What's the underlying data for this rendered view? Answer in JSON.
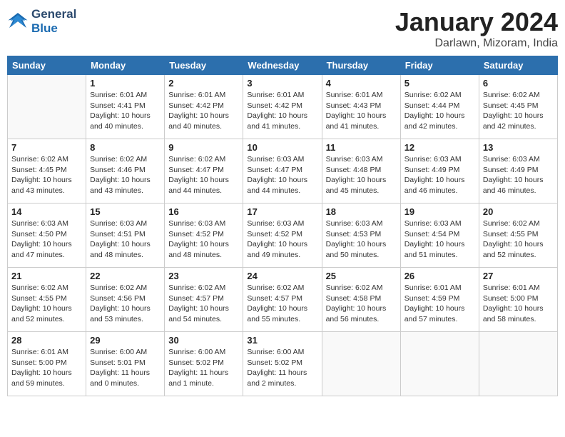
{
  "header": {
    "logo_line1": "General",
    "logo_line2": "Blue",
    "month_title": "January 2024",
    "location": "Darlawn, Mizoram, India"
  },
  "days_of_week": [
    "Sunday",
    "Monday",
    "Tuesday",
    "Wednesday",
    "Thursday",
    "Friday",
    "Saturday"
  ],
  "weeks": [
    [
      {
        "day": "",
        "info": ""
      },
      {
        "day": "1",
        "info": "Sunrise: 6:01 AM\nSunset: 4:41 PM\nDaylight: 10 hours\nand 40 minutes."
      },
      {
        "day": "2",
        "info": "Sunrise: 6:01 AM\nSunset: 4:42 PM\nDaylight: 10 hours\nand 40 minutes."
      },
      {
        "day": "3",
        "info": "Sunrise: 6:01 AM\nSunset: 4:42 PM\nDaylight: 10 hours\nand 41 minutes."
      },
      {
        "day": "4",
        "info": "Sunrise: 6:01 AM\nSunset: 4:43 PM\nDaylight: 10 hours\nand 41 minutes."
      },
      {
        "day": "5",
        "info": "Sunrise: 6:02 AM\nSunset: 4:44 PM\nDaylight: 10 hours\nand 42 minutes."
      },
      {
        "day": "6",
        "info": "Sunrise: 6:02 AM\nSunset: 4:45 PM\nDaylight: 10 hours\nand 42 minutes."
      }
    ],
    [
      {
        "day": "7",
        "info": "Sunrise: 6:02 AM\nSunset: 4:45 PM\nDaylight: 10 hours\nand 43 minutes."
      },
      {
        "day": "8",
        "info": "Sunrise: 6:02 AM\nSunset: 4:46 PM\nDaylight: 10 hours\nand 43 minutes."
      },
      {
        "day": "9",
        "info": "Sunrise: 6:02 AM\nSunset: 4:47 PM\nDaylight: 10 hours\nand 44 minutes."
      },
      {
        "day": "10",
        "info": "Sunrise: 6:03 AM\nSunset: 4:47 PM\nDaylight: 10 hours\nand 44 minutes."
      },
      {
        "day": "11",
        "info": "Sunrise: 6:03 AM\nSunset: 4:48 PM\nDaylight: 10 hours\nand 45 minutes."
      },
      {
        "day": "12",
        "info": "Sunrise: 6:03 AM\nSunset: 4:49 PM\nDaylight: 10 hours\nand 46 minutes."
      },
      {
        "day": "13",
        "info": "Sunrise: 6:03 AM\nSunset: 4:49 PM\nDaylight: 10 hours\nand 46 minutes."
      }
    ],
    [
      {
        "day": "14",
        "info": "Sunrise: 6:03 AM\nSunset: 4:50 PM\nDaylight: 10 hours\nand 47 minutes."
      },
      {
        "day": "15",
        "info": "Sunrise: 6:03 AM\nSunset: 4:51 PM\nDaylight: 10 hours\nand 48 minutes."
      },
      {
        "day": "16",
        "info": "Sunrise: 6:03 AM\nSunset: 4:52 PM\nDaylight: 10 hours\nand 48 minutes."
      },
      {
        "day": "17",
        "info": "Sunrise: 6:03 AM\nSunset: 4:52 PM\nDaylight: 10 hours\nand 49 minutes."
      },
      {
        "day": "18",
        "info": "Sunrise: 6:03 AM\nSunset: 4:53 PM\nDaylight: 10 hours\nand 50 minutes."
      },
      {
        "day": "19",
        "info": "Sunrise: 6:03 AM\nSunset: 4:54 PM\nDaylight: 10 hours\nand 51 minutes."
      },
      {
        "day": "20",
        "info": "Sunrise: 6:02 AM\nSunset: 4:55 PM\nDaylight: 10 hours\nand 52 minutes."
      }
    ],
    [
      {
        "day": "21",
        "info": "Sunrise: 6:02 AM\nSunset: 4:55 PM\nDaylight: 10 hours\nand 52 minutes."
      },
      {
        "day": "22",
        "info": "Sunrise: 6:02 AM\nSunset: 4:56 PM\nDaylight: 10 hours\nand 53 minutes."
      },
      {
        "day": "23",
        "info": "Sunrise: 6:02 AM\nSunset: 4:57 PM\nDaylight: 10 hours\nand 54 minutes."
      },
      {
        "day": "24",
        "info": "Sunrise: 6:02 AM\nSunset: 4:57 PM\nDaylight: 10 hours\nand 55 minutes."
      },
      {
        "day": "25",
        "info": "Sunrise: 6:02 AM\nSunset: 4:58 PM\nDaylight: 10 hours\nand 56 minutes."
      },
      {
        "day": "26",
        "info": "Sunrise: 6:01 AM\nSunset: 4:59 PM\nDaylight: 10 hours\nand 57 minutes."
      },
      {
        "day": "27",
        "info": "Sunrise: 6:01 AM\nSunset: 5:00 PM\nDaylight: 10 hours\nand 58 minutes."
      }
    ],
    [
      {
        "day": "28",
        "info": "Sunrise: 6:01 AM\nSunset: 5:00 PM\nDaylight: 10 hours\nand 59 minutes."
      },
      {
        "day": "29",
        "info": "Sunrise: 6:00 AM\nSunset: 5:01 PM\nDaylight: 11 hours\nand 0 minutes."
      },
      {
        "day": "30",
        "info": "Sunrise: 6:00 AM\nSunset: 5:02 PM\nDaylight: 11 hours\nand 1 minute."
      },
      {
        "day": "31",
        "info": "Sunrise: 6:00 AM\nSunset: 5:02 PM\nDaylight: 11 hours\nand 2 minutes."
      },
      {
        "day": "",
        "info": ""
      },
      {
        "day": "",
        "info": ""
      },
      {
        "day": "",
        "info": ""
      }
    ]
  ]
}
